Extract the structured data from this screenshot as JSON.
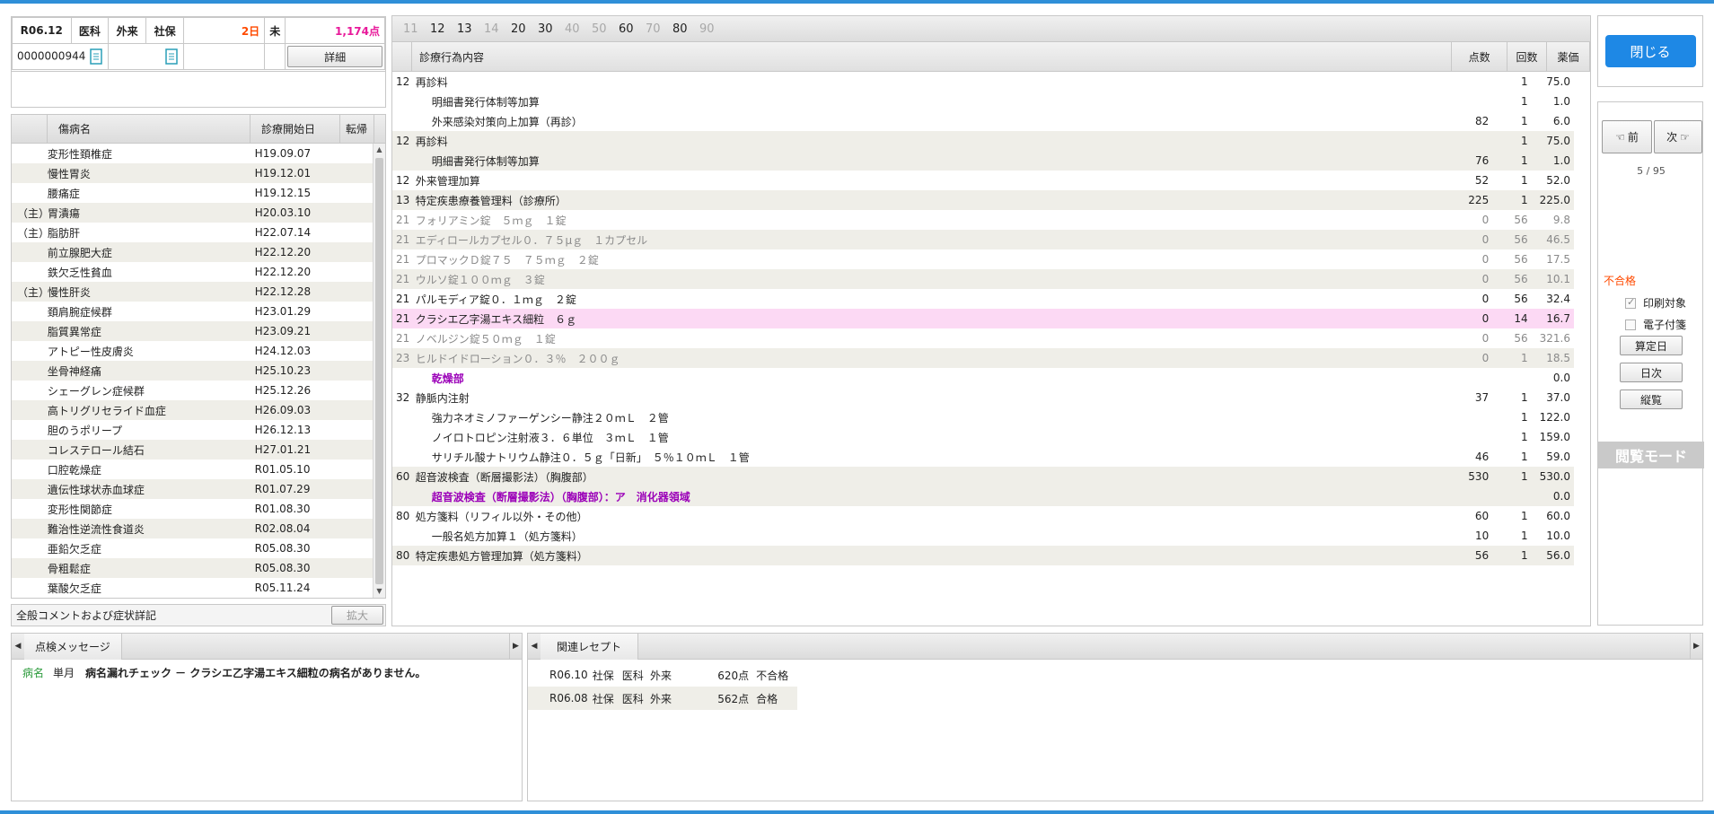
{
  "header": {
    "period": "R06.12",
    "category": "医科",
    "visit_type": "外来",
    "insurance": "社保",
    "days": "2日",
    "status": "未",
    "points": "1,174点",
    "patient_id": "0000000944",
    "detail_button": "詳細",
    "colors": {
      "days": "#ff4a00",
      "points": "#e8199a"
    }
  },
  "disease_list": {
    "columns": [
      "傷病名",
      "診療開始日",
      "転帰"
    ],
    "rows": [
      {
        "prefix": "",
        "name": "変形性頚椎症",
        "date": "H19.09.07",
        "outcome": ""
      },
      {
        "prefix": "",
        "name": "慢性胃炎",
        "date": "H19.12.01",
        "outcome": ""
      },
      {
        "prefix": "",
        "name": "腰痛症",
        "date": "H19.12.15",
        "outcome": ""
      },
      {
        "prefix": "（主）",
        "name": "胃潰瘍",
        "date": "H20.03.10",
        "outcome": ""
      },
      {
        "prefix": "（主）",
        "name": "脂肪肝",
        "date": "H22.07.14",
        "outcome": ""
      },
      {
        "prefix": "",
        "name": "前立腺肥大症",
        "date": "H22.12.20",
        "outcome": ""
      },
      {
        "prefix": "",
        "name": "鉄欠乏性貧血",
        "date": "H22.12.20",
        "outcome": ""
      },
      {
        "prefix": "（主）",
        "name": "慢性肝炎",
        "date": "H22.12.28",
        "outcome": ""
      },
      {
        "prefix": "",
        "name": "頚肩腕症候群",
        "date": "H23.01.29",
        "outcome": ""
      },
      {
        "prefix": "",
        "name": "脂質異常症",
        "date": "H23.09.21",
        "outcome": ""
      },
      {
        "prefix": "",
        "name": "アトピー性皮膚炎",
        "date": "H24.12.03",
        "outcome": ""
      },
      {
        "prefix": "",
        "name": "坐骨神経痛",
        "date": "H25.10.23",
        "outcome": ""
      },
      {
        "prefix": "",
        "name": "シェーグレン症候群",
        "date": "H25.12.26",
        "outcome": ""
      },
      {
        "prefix": "",
        "name": "高トリグリセライド血症",
        "date": "H26.09.03",
        "outcome": ""
      },
      {
        "prefix": "",
        "name": "胆のうポリープ",
        "date": "H26.12.13",
        "outcome": ""
      },
      {
        "prefix": "",
        "name": "コレステロール結石",
        "date": "H27.01.21",
        "outcome": ""
      },
      {
        "prefix": "",
        "name": "口腔乾燥症",
        "date": "R01.05.10",
        "outcome": ""
      },
      {
        "prefix": "",
        "name": "遺伝性球状赤血球症",
        "date": "R01.07.29",
        "outcome": ""
      },
      {
        "prefix": "",
        "name": "変形性関節症",
        "date": "R01.08.30",
        "outcome": ""
      },
      {
        "prefix": "",
        "name": "難治性逆流性食道炎",
        "date": "R02.08.04",
        "outcome": ""
      },
      {
        "prefix": "",
        "name": "亜鉛欠乏症",
        "date": "R05.08.30",
        "outcome": ""
      },
      {
        "prefix": "",
        "name": "骨粗鬆症",
        "date": "R05.08.30",
        "outcome": ""
      },
      {
        "prefix": "",
        "name": "葉酸欠乏症",
        "date": "R05.11.24",
        "outcome": ""
      }
    ],
    "comment_label": "全般コメントおよび症状詳記",
    "expand_button": "拡大"
  },
  "code_tabs": [
    {
      "label": "11",
      "active": false
    },
    {
      "label": "12",
      "active": true
    },
    {
      "label": "13",
      "active": true
    },
    {
      "label": "14",
      "active": false
    },
    {
      "label": "20",
      "active": true
    },
    {
      "label": "30",
      "active": true
    },
    {
      "label": "40",
      "active": false
    },
    {
      "label": "50",
      "active": false
    },
    {
      "label": "60",
      "active": true
    },
    {
      "label": "70",
      "active": false
    },
    {
      "label": "80",
      "active": true
    },
    {
      "label": "90",
      "active": false
    }
  ],
  "treatment": {
    "columns": [
      "診療行為内容",
      "点数",
      "回数",
      "薬価"
    ],
    "rows": [
      {
        "code": "12",
        "name": "再診料",
        "points": "",
        "count": "1",
        "price": "75.0",
        "style": "normal"
      },
      {
        "code": "",
        "name": "明細書発行体制等加算",
        "points": "",
        "count": "1",
        "price": "1.0",
        "style": "normal"
      },
      {
        "code": "",
        "name": "外来感染対策向上加算（再診）",
        "points": "82",
        "count": "1",
        "price": "6.0",
        "style": "normal"
      },
      {
        "code": "12",
        "name": "再診料",
        "points": "",
        "count": "1",
        "price": "75.0",
        "style": "alt"
      },
      {
        "code": "",
        "name": "明細書発行体制等加算",
        "points": "76",
        "count": "1",
        "price": "1.0",
        "style": "alt"
      },
      {
        "code": "12",
        "name": "外来管理加算",
        "points": "52",
        "count": "1",
        "price": "52.0",
        "style": "normal"
      },
      {
        "code": "13",
        "name": "特定疾患療養管理料（診療所）",
        "points": "225",
        "count": "1",
        "price": "225.0",
        "style": "alt"
      },
      {
        "code": "21",
        "name": "フォリアミン錠　５ｍｇ　１錠",
        "points": "0",
        "count": "56",
        "price": "9.8",
        "style": "grey"
      },
      {
        "code": "21",
        "name": "エディロールカプセル０．７５μｇ　１カプセル",
        "points": "0",
        "count": "56",
        "price": "46.5",
        "style": "grey-alt"
      },
      {
        "code": "21",
        "name": "プロマックＤ錠７５　７５ｍｇ　２錠",
        "points": "0",
        "count": "56",
        "price": "17.5",
        "style": "grey"
      },
      {
        "code": "21",
        "name": "ウルソ錠１００ｍｇ　３錠",
        "points": "0",
        "count": "56",
        "price": "10.1",
        "style": "grey-alt"
      },
      {
        "code": "21",
        "name": "パルモディア錠０．１ｍｇ　２錠",
        "points": "0",
        "count": "56",
        "price": "32.4",
        "style": "normal"
      },
      {
        "code": "21",
        "name": "クラシエ乙字湯エキス細粒　６ｇ",
        "points": "0",
        "count": "14",
        "price": "16.7",
        "style": "selected"
      },
      {
        "code": "21",
        "name": "ノベルジン錠５０ｍｇ　１錠",
        "points": "0",
        "count": "56",
        "price": "321.6",
        "style": "grey"
      },
      {
        "code": "23",
        "name": "ヒルドイドローション０．３％　２００ｇ",
        "points": "0",
        "count": "1",
        "price": "18.5",
        "style": "grey-alt"
      },
      {
        "code": "",
        "name": "乾燥部",
        "points": "",
        "count": "",
        "price": "0.0",
        "style": "purple"
      },
      {
        "code": "32",
        "name": "静脈内注射",
        "points": "37",
        "count": "1",
        "price": "37.0",
        "style": "normal"
      },
      {
        "code": "",
        "name": "強力ネオミノファーゲンシー静注２０ｍＬ　２管",
        "points": "",
        "count": "1",
        "price": "122.0",
        "style": "normal"
      },
      {
        "code": "",
        "name": "ノイロトロピン注射液３．６単位　３ｍＬ　１管",
        "points": "",
        "count": "1",
        "price": "159.0",
        "style": "normal"
      },
      {
        "code": "",
        "name": "サリチル酸ナトリウム静注０．５ｇ「日新」　５％１０ｍＬ　１管",
        "points": "46",
        "count": "1",
        "price": "59.0",
        "style": "normal"
      },
      {
        "code": "60",
        "name": "超音波検査（断層撮影法）（胸腹部）",
        "points": "530",
        "count": "1",
        "price": "530.0",
        "style": "alt"
      },
      {
        "code": "",
        "name": "超音波検査（断層撮影法）（胸腹部）：ア　消化器領域",
        "points": "",
        "count": "",
        "price": "0.0",
        "style": "purple-alt"
      },
      {
        "code": "80",
        "name": "処方箋料（リフィル以外・その他）",
        "points": "60",
        "count": "1",
        "price": "60.0",
        "style": "normal"
      },
      {
        "code": "",
        "name": "一般名処方加算１（処方箋料）",
        "points": "10",
        "count": "1",
        "price": "10.0",
        "style": "normal"
      },
      {
        "code": "80",
        "name": "特定疾患処方管理加算（処方箋料）",
        "points": "56",
        "count": "1",
        "price": "56.0",
        "style": "alt"
      }
    ]
  },
  "right_panel": {
    "close_button": "閉じる",
    "prev_button": "前",
    "next_button": "次",
    "page_counter": "5 / 95",
    "result": "不合格",
    "result_color": "#ff4a00",
    "print_target_label": "印刷対象",
    "print_target_checked": true,
    "e_attach_label": "電子付箋",
    "e_attach_checked": false,
    "calc_date_button": "算定日",
    "daily_button": "日次",
    "vertical_button": "縦覧",
    "view_mode_label": "閲覧モード"
  },
  "check_messages": {
    "tab_label": "点検メッセージ",
    "messages": [
      {
        "category": "病名",
        "scope": "単月",
        "text": "病名漏れチェック － クラシエ乙字湯エキス細粒の病名がありません。"
      }
    ]
  },
  "related_receipts": {
    "tab_label": "関連レセプト",
    "rows": [
      {
        "period": "R06.10",
        "insurance": "社保",
        "category": "医科",
        "visit": "外来",
        "points": "620点",
        "result": "不合格"
      },
      {
        "period": "R06.08",
        "insurance": "社保",
        "category": "医科",
        "visit": "外来",
        "points": "562点",
        "result": "合格"
      }
    ]
  }
}
